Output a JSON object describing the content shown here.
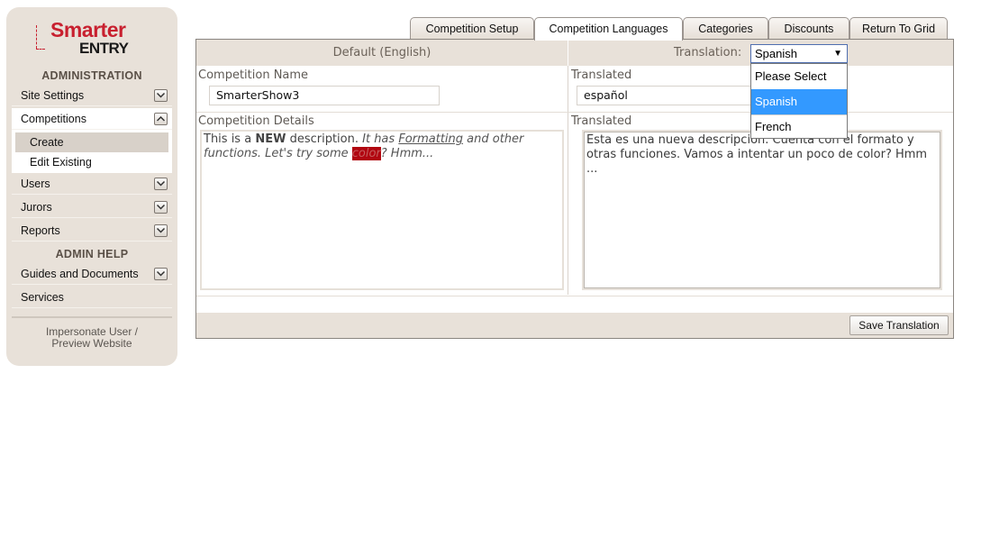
{
  "brand": {
    "logo_line1": "Smarter",
    "logo_line2": "ENTRY",
    "accent": "#c8202f"
  },
  "sidebar": {
    "section_admin": "ADMINISTRATION",
    "items": {
      "site_settings": "Site Settings",
      "competitions": "Competitions",
      "create": "Create",
      "edit_existing": "Edit Existing",
      "users": "Users",
      "jurors": "Jurors",
      "reports": "Reports",
      "guides": "Guides and Documents",
      "services": "Services"
    },
    "section_help": "ADMIN HELP",
    "impersonate_line1": "Impersonate User /",
    "impersonate_line2": "Preview Website"
  },
  "tabs": {
    "setup": "Competition Setup",
    "languages": "Competition Languages",
    "categories": "Categories",
    "discounts": "Discounts",
    "return": "Return To Grid",
    "active": "Competition Languages"
  },
  "panel": {
    "default_header": "Default (English)",
    "translation_label": "Translation:",
    "name_label": "Competition Name",
    "name_value": "SmarterShow3",
    "translated_label": "Translated",
    "translated_name_value": "español",
    "details_label": "Competition Details",
    "details": {
      "part1": "This is a ",
      "bold": "NEW",
      "part2": " description.  ",
      "it1": "It has ",
      "underline": "Formatting",
      "it2": " and other functions.   Let's try some ",
      "highlight": "color",
      "it3": "? Hmm..."
    },
    "translated_details_value": "Esta es una nueva descripción. Cuenta con el formato y otras funciones. Vamos a intentar un poco de color? Hmm ...",
    "save_button": "Save Translation"
  },
  "language_select": {
    "selected": "Spanish",
    "options": [
      "Please Select",
      "Spanish",
      "French"
    ],
    "highlighted": "Spanish"
  }
}
